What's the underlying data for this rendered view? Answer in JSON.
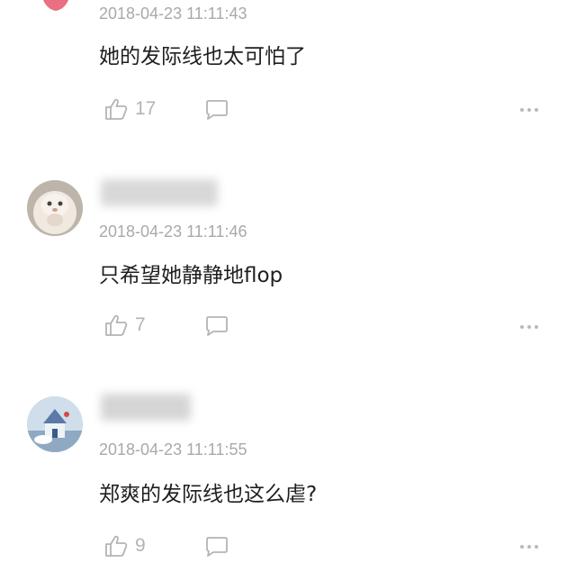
{
  "comments": [
    {
      "timestamp": "2018-04-23 11:11:43",
      "text": "她的发际线也太可怕了",
      "likes": "17",
      "like_icon": "thumbs-up-icon",
      "reply_icon": "comment-bubble-icon",
      "more_icon": "more-dots-icon"
    },
    {
      "timestamp": "2018-04-23 11:11:46",
      "text": "只希望她静静地flop",
      "likes": "7",
      "like_icon": "thumbs-up-icon",
      "reply_icon": "comment-bubble-icon",
      "more_icon": "more-dots-icon"
    },
    {
      "timestamp": "2018-04-23 11:11:55",
      "text": "郑爽的发际线也这么虐?",
      "likes": "9",
      "like_icon": "thumbs-up-icon",
      "reply_icon": "comment-bubble-icon",
      "more_icon": "more-dots-icon"
    }
  ],
  "colors": {
    "timestamp": "#a9a9a9",
    "text": "#1f1f1f",
    "icon": "#b4b4b4",
    "background": "#ffffff"
  }
}
